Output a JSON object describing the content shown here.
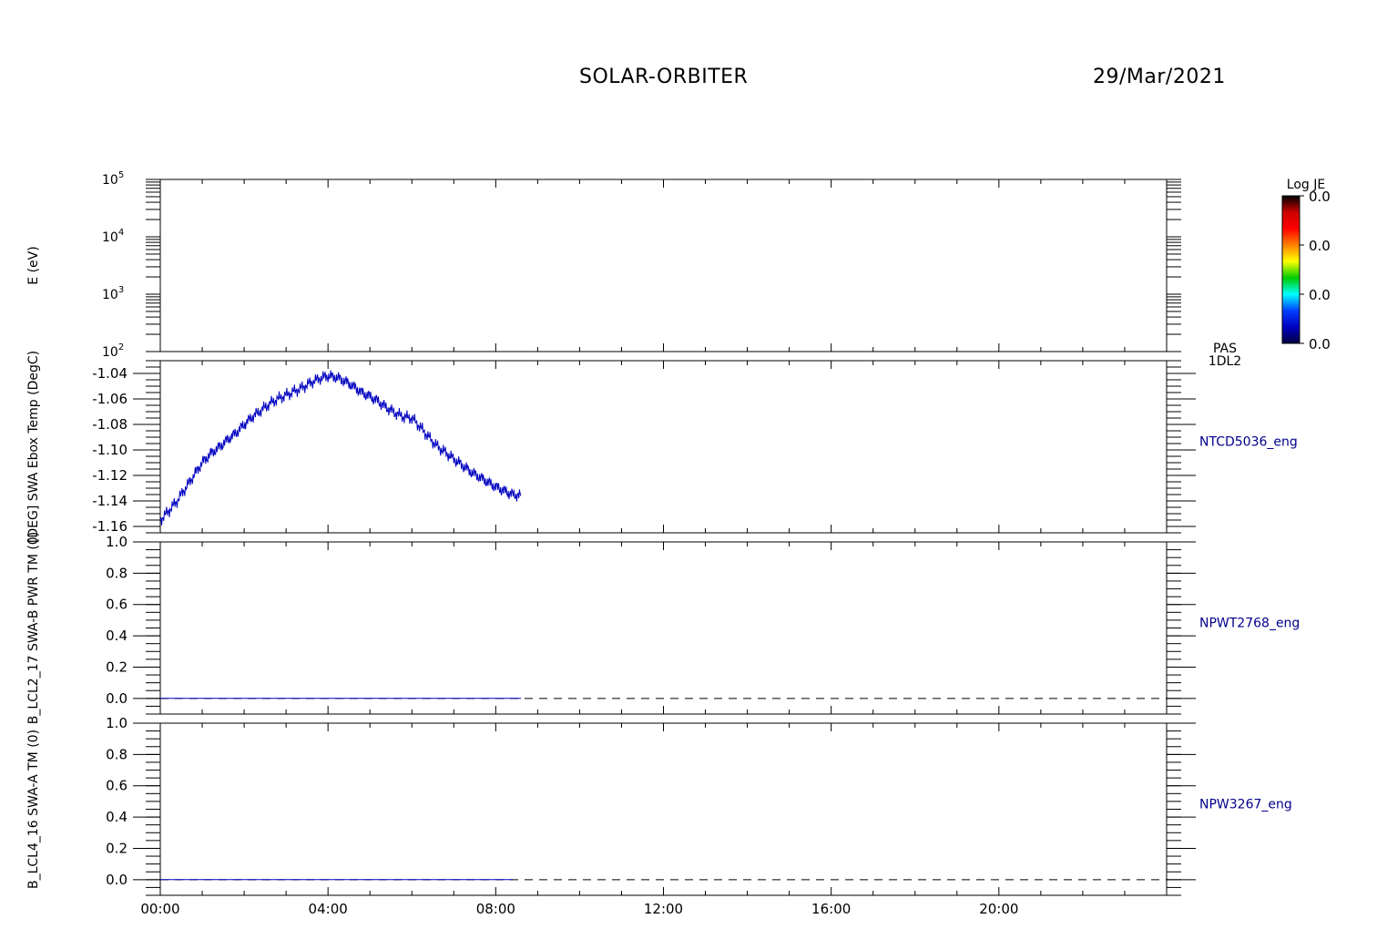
{
  "header": {
    "title": "SOLAR-ORBITER",
    "date": "29/Mar/2021"
  },
  "colorbar": {
    "label": "Log JE",
    "ticks": [
      "0.0",
      "0.0",
      "0.0",
      "0.0"
    ],
    "colors": [
      "#000000",
      "#cc0000",
      "#ff0000",
      "#ff8000",
      "#ffff00",
      "#00cc00",
      "#00ffff",
      "#0040ff",
      "#0000c0",
      "#000040"
    ]
  },
  "x_axis": {
    "ticks": [
      "00:00",
      "04:00",
      "08:00",
      "12:00",
      "16:00",
      "20:00"
    ],
    "tick_hours": [
      0,
      4,
      8,
      12,
      16,
      20
    ],
    "range_hours": [
      0,
      24
    ]
  },
  "colors": {
    "data_line": "#0000c0",
    "axis": "#000000",
    "label_text": "#00008b"
  },
  "chart_data": [
    {
      "type": "heatmap",
      "ylabel": "E (eV)",
      "yscale": "log",
      "ylim": [
        100,
        100000
      ],
      "yticks": [
        {
          "base": "10",
          "exp": "2"
        },
        {
          "base": "10",
          "exp": "3"
        },
        {
          "base": "10",
          "exp": "4"
        },
        {
          "base": "10",
          "exp": "5"
        }
      ],
      "right_label": [
        "PAS",
        "1DL2"
      ],
      "values": []
    },
    {
      "type": "line",
      "ylabel": "[DEG] SWA Ebox Temp (DegC)",
      "right_label": "NTCD5036_eng",
      "ylim": [
        -1.165,
        -1.03
      ],
      "yticks": [
        "-1.04",
        "-1.06",
        "-1.08",
        "-1.10",
        "-1.12",
        "-1.14",
        "-1.16"
      ],
      "ytick_values": [
        -1.04,
        -1.06,
        -1.08,
        -1.1,
        -1.12,
        -1.14,
        -1.16
      ],
      "series": [
        {
          "x_hours": [
            0.0,
            0.2,
            0.4,
            0.6,
            0.8,
            1.0,
            1.2,
            1.4,
            1.6,
            1.8,
            2.0,
            2.2,
            2.4,
            2.6,
            2.8,
            3.0,
            3.2,
            3.4,
            3.6,
            3.8,
            4.0,
            4.2,
            4.4,
            4.6,
            4.8,
            5.0,
            5.2,
            5.4,
            5.6,
            5.8,
            6.0,
            6.2,
            6.4,
            6.6,
            6.8,
            7.0,
            7.2,
            7.4,
            7.6,
            7.8,
            8.0,
            8.2,
            8.4,
            8.6
          ],
          "y": [
            -1.155,
            -1.148,
            -1.14,
            -1.13,
            -1.12,
            -1.11,
            -1.103,
            -1.098,
            -1.092,
            -1.087,
            -1.08,
            -1.074,
            -1.069,
            -1.064,
            -1.06,
            -1.057,
            -1.054,
            -1.051,
            -1.047,
            -1.044,
            -1.042,
            -1.043,
            -1.046,
            -1.05,
            -1.055,
            -1.058,
            -1.062,
            -1.067,
            -1.071,
            -1.074,
            -1.075,
            -1.082,
            -1.09,
            -1.097,
            -1.102,
            -1.107,
            -1.112,
            -1.117,
            -1.121,
            -1.125,
            -1.129,
            -1.132,
            -1.135,
            -1.136
          ]
        }
      ]
    },
    {
      "type": "line",
      "ylabel": "B_LCL2_17 SWA-B PWR TM (0)",
      "right_label": "NPWT2768_eng",
      "ylim": [
        -0.1,
        1.0
      ],
      "yticks": [
        "1.0",
        "0.8",
        "0.6",
        "0.4",
        "0.2",
        "0.0"
      ],
      "ytick_values": [
        1.0,
        0.8,
        0.6,
        0.4,
        0.2,
        0.0
      ],
      "series": [
        {
          "x_hours": [
            0.0,
            8.6
          ],
          "y": [
            0.0,
            0.0
          ]
        }
      ],
      "reference_line": {
        "y": 0.0,
        "style": "dashed"
      }
    },
    {
      "type": "line",
      "ylabel": "B_LCL4_16 SWA-A TM (0)",
      "right_label": "NPW3267_eng",
      "ylim": [
        -0.1,
        1.0
      ],
      "yticks": [
        "1.0",
        "0.8",
        "0.6",
        "0.4",
        "0.2",
        "0.0"
      ],
      "ytick_values": [
        1.0,
        0.8,
        0.6,
        0.4,
        0.2,
        0.0
      ],
      "series": [
        {
          "x_hours": [
            0.0,
            8.4
          ],
          "y": [
            0.0,
            0.0
          ]
        }
      ],
      "reference_line": {
        "y": 0.0,
        "style": "dashed"
      }
    }
  ]
}
